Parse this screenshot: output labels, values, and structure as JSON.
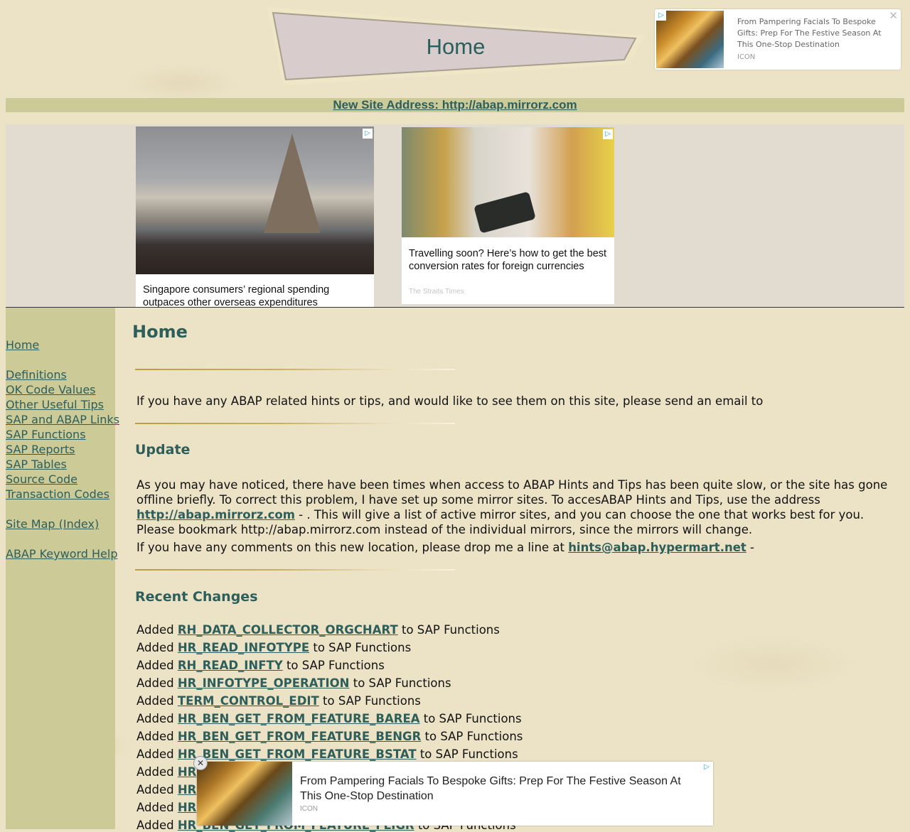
{
  "banner": {
    "title": "Home"
  },
  "top_ad": {
    "text": "From Pampering Facials To Bespoke Gifts: Prep For The Festive Season At This One-Stop Destination",
    "source": "ICON",
    "adchoice_icon": "▷",
    "close_icon": "✕"
  },
  "new_site": {
    "label": "New Site Address: http://abap.mirrorz.com"
  },
  "ads": [
    {
      "headline": "Singapore consumers’ regional spending outpaces other overseas expenditures",
      "source": "",
      "adchoice_icon": "▷"
    },
    {
      "headline": "Travelling soon? Here’s how to get the best conversion rates for foreign currencies",
      "source": "The Straits Times",
      "adchoice_icon": "▷"
    }
  ],
  "sidebar": {
    "items": [
      {
        "label": "Home"
      },
      {
        "label": "Definitions"
      },
      {
        "label": "OK Code Values"
      },
      {
        "label": "Other Useful Tips"
      },
      {
        "label": "SAP and ABAP Links"
      },
      {
        "label": "SAP Functions"
      },
      {
        "label": "SAP Reports"
      },
      {
        "label": "SAP Tables"
      },
      {
        "label": "Source Code"
      },
      {
        "label": "Transaction Codes"
      },
      {
        "label": "Site Map (Index)"
      },
      {
        "label": "ABAP Keyword Help"
      }
    ]
  },
  "main": {
    "title": "Home",
    "intro": "If you have any ABAP related hints or tips, and would like to see them on this site, please send an email to",
    "update": {
      "heading": "Update",
      "para1_before": "As you may have noticed, there have been times when access to ABAP Hints and Tips has been quite slow, or the site has gone offline briefly. To correct this problem, I have set up some mirror sites. To accesABAP Hints and Tips, use the address ",
      "para1_link": "http://abap.mirrorz.com",
      "para1_after": " - . This will give a list of active mirror sites, and you can choose the one that works best for you. Please bookmark http://abap.mirrorz.com instead of the individual mirrors, since the mirrors will change.",
      "para2_before": "If you have any comments on this new location, please drop me a line at ",
      "para2_link": "hints@abap.hypermart.net",
      "para2_after": " -"
    },
    "recent": {
      "heading": "Recent Changes",
      "prefix": "Added ",
      "suffix": " to SAP Functions",
      "items": [
        "RH_DATA_COLLECTOR_ORGCHART",
        "HR_READ_INFOTYPE",
        "RH_READ_INFTY",
        "HR_INFOTYPE_OPERATION",
        "TERM_CONTROL_EDIT",
        "HR_BEN_GET_FROM_FEATURE_BAREA",
        "HR_BEN_GET_FROM_FEATURE_BENGR",
        "HR_BEN_GET_FROM_FEATURE_BSTAT",
        "HR",
        "HR",
        "HR",
        "HR_BEN_GET_FROM_FEATURE_FLIGR"
      ]
    }
  },
  "bottom_ad": {
    "text": "From Pampering Facials To Bespoke Gifts: Prep For The Festive Season At This One-Stop Destination",
    "source": "ICON",
    "adchoice_icon": "▷",
    "close_icon": "✕"
  }
}
